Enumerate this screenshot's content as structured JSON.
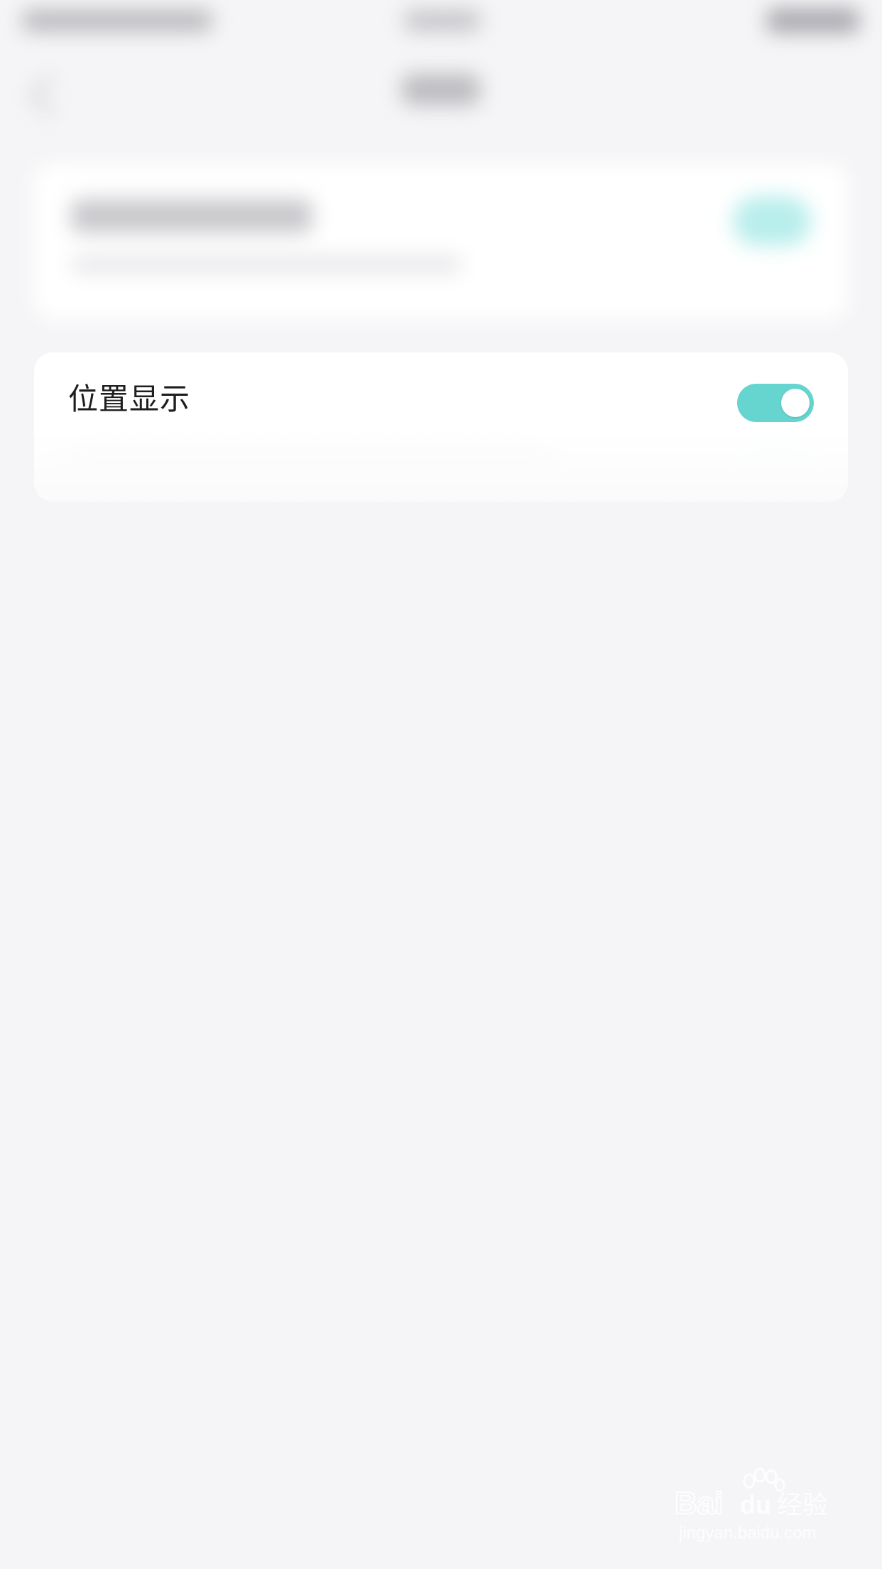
{
  "settings": {
    "location_display": {
      "label": "位置显示",
      "enabled": true
    }
  },
  "colors": {
    "background": "#f5f5f7",
    "toggle_on": "#66d5d0",
    "label_text": "#1e1e1e"
  },
  "watermark": {
    "brand": "Baidu 经验",
    "url": "jingyan.baidu.com"
  }
}
